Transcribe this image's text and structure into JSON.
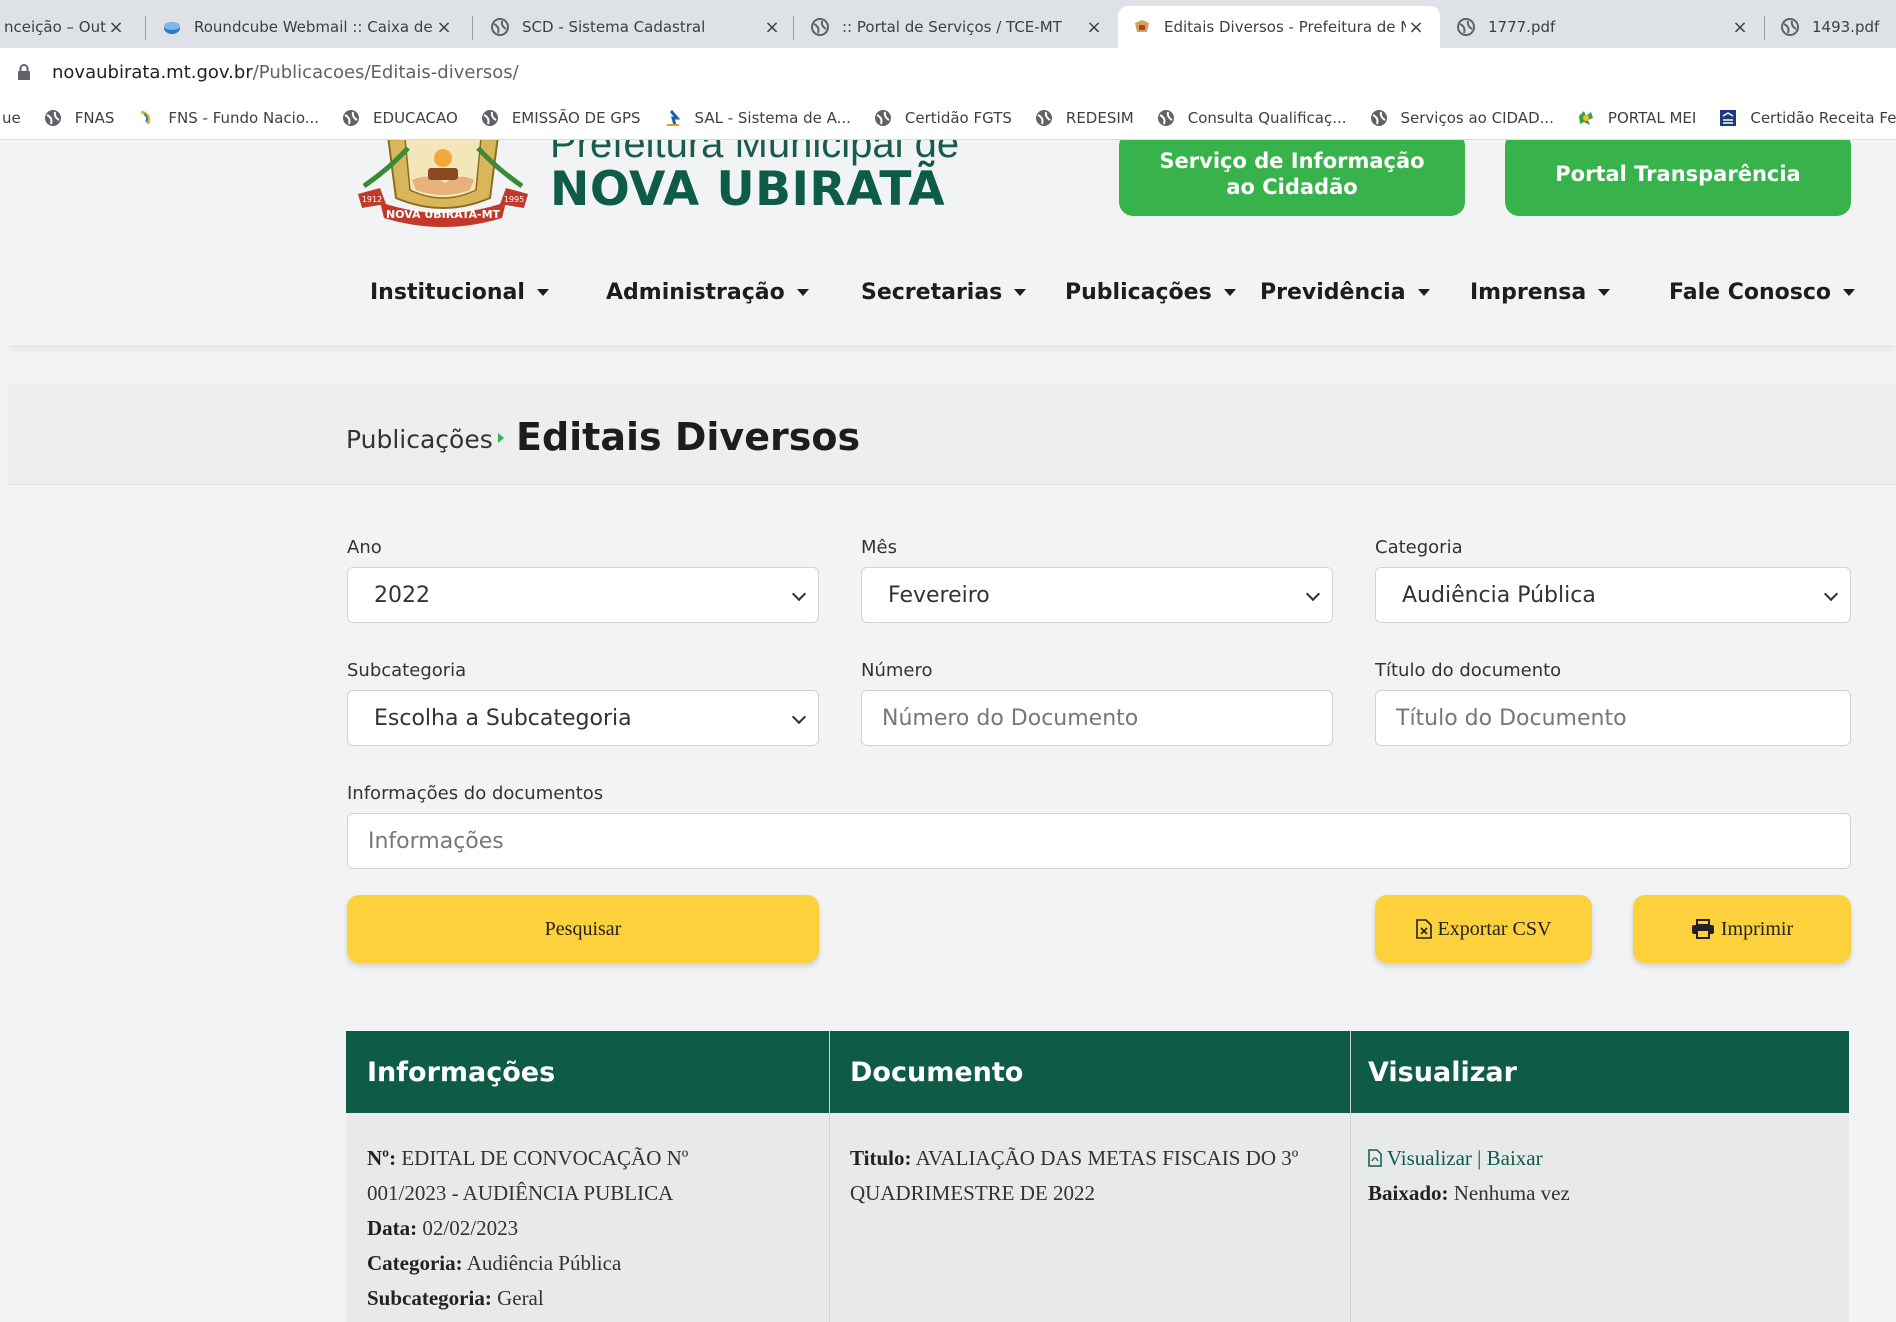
{
  "browser": {
    "tabs": [
      {
        "title": "nceição – Out",
        "active": false
      },
      {
        "title": "Roundcube Webmail :: Caixa de e",
        "active": false
      },
      {
        "title": "SCD - Sistema Cadastral",
        "active": false
      },
      {
        "title": ":: Portal de Serviços / TCE-MT",
        "active": false
      },
      {
        "title": "Editais Diversos - Prefeitura de N",
        "active": true
      },
      {
        "title": "1777.pdf",
        "active": false
      },
      {
        "title": "1493.pdf",
        "active": false
      }
    ],
    "address": {
      "host": "novaubirata.mt.gov.br",
      "path": "/Publicacoes/Editais-diversos/"
    },
    "bookmarks": [
      "ue",
      "FNAS",
      "FNS - Fundo Nacio...",
      "EDUCACAO",
      "EMISSÃO DE GPS",
      "SAL - Sistema de A...",
      "Certidão FGTS",
      "REDESIM",
      "Consulta Qualificaç...",
      "Serviços ao CIDAD...",
      "PORTAL MEI",
      "Certidão Receita Fe..."
    ]
  },
  "header": {
    "brand_top": "Prefeitura Municipal de",
    "brand_main": "NOVA UBIRATÃ",
    "logo": {
      "ribbon": "NOVA UBIRATÃ-MT",
      "year_left": "1912",
      "year_right": "1995"
    },
    "sic_button": "Serviço de Informação ao Cidadão",
    "transparency_button": "Portal Transparência",
    "nav": [
      "Institucional",
      "Administração",
      "Secretarias",
      "Publicações",
      "Previdência",
      "Imprensa",
      "Fale Conosco"
    ]
  },
  "breadcrumb": {
    "parent": "Publicações",
    "current": "Editais Diversos"
  },
  "filters": {
    "ano": {
      "label": "Ano",
      "value": "2022"
    },
    "mes": {
      "label": "Mês",
      "value": "Fevereiro"
    },
    "categoria": {
      "label": "Categoria",
      "value": "Audiência Pública"
    },
    "subcategoria": {
      "label": "Subcategoria",
      "value": "Escolha a Subcategoria"
    },
    "numero": {
      "label": "Número",
      "placeholder": "Número do Documento"
    },
    "titulo": {
      "label": "Título do documento",
      "placeholder": "Título do Documento"
    },
    "informacoes": {
      "label": "Informações do documentos",
      "placeholder": "Informações"
    },
    "search_button": "Pesquisar",
    "export_button": "Exportar CSV",
    "print_button": "Imprimir"
  },
  "table": {
    "headers": [
      "Informações",
      "Documento",
      "Visualizar"
    ],
    "rows": [
      {
        "numero_label": "Nº:",
        "numero_line1": "EDITAL DE CONVOCAÇÃO Nº",
        "numero_line2": "001/2023 - AUDIÊNCIA PUBLICA",
        "data_label": "Data:",
        "data": "02/02/2023",
        "categoria_label": "Categoria:",
        "categoria": "Audiência Pública",
        "subcategoria_label": "Subcategoria:",
        "subcategoria": "Geral",
        "titulo_label": "Titulo:",
        "titulo_line1": "AVALIAÇÃO DAS METAS FISCAIS DO 3º",
        "titulo_line2": "QUADRIMESTRE DE 2022",
        "view_link": "Visualizar",
        "link_sep": "|",
        "download_link": "Baixar",
        "downloads_label": "Baixado:",
        "downloads": "Nenhuma vez"
      }
    ]
  }
}
